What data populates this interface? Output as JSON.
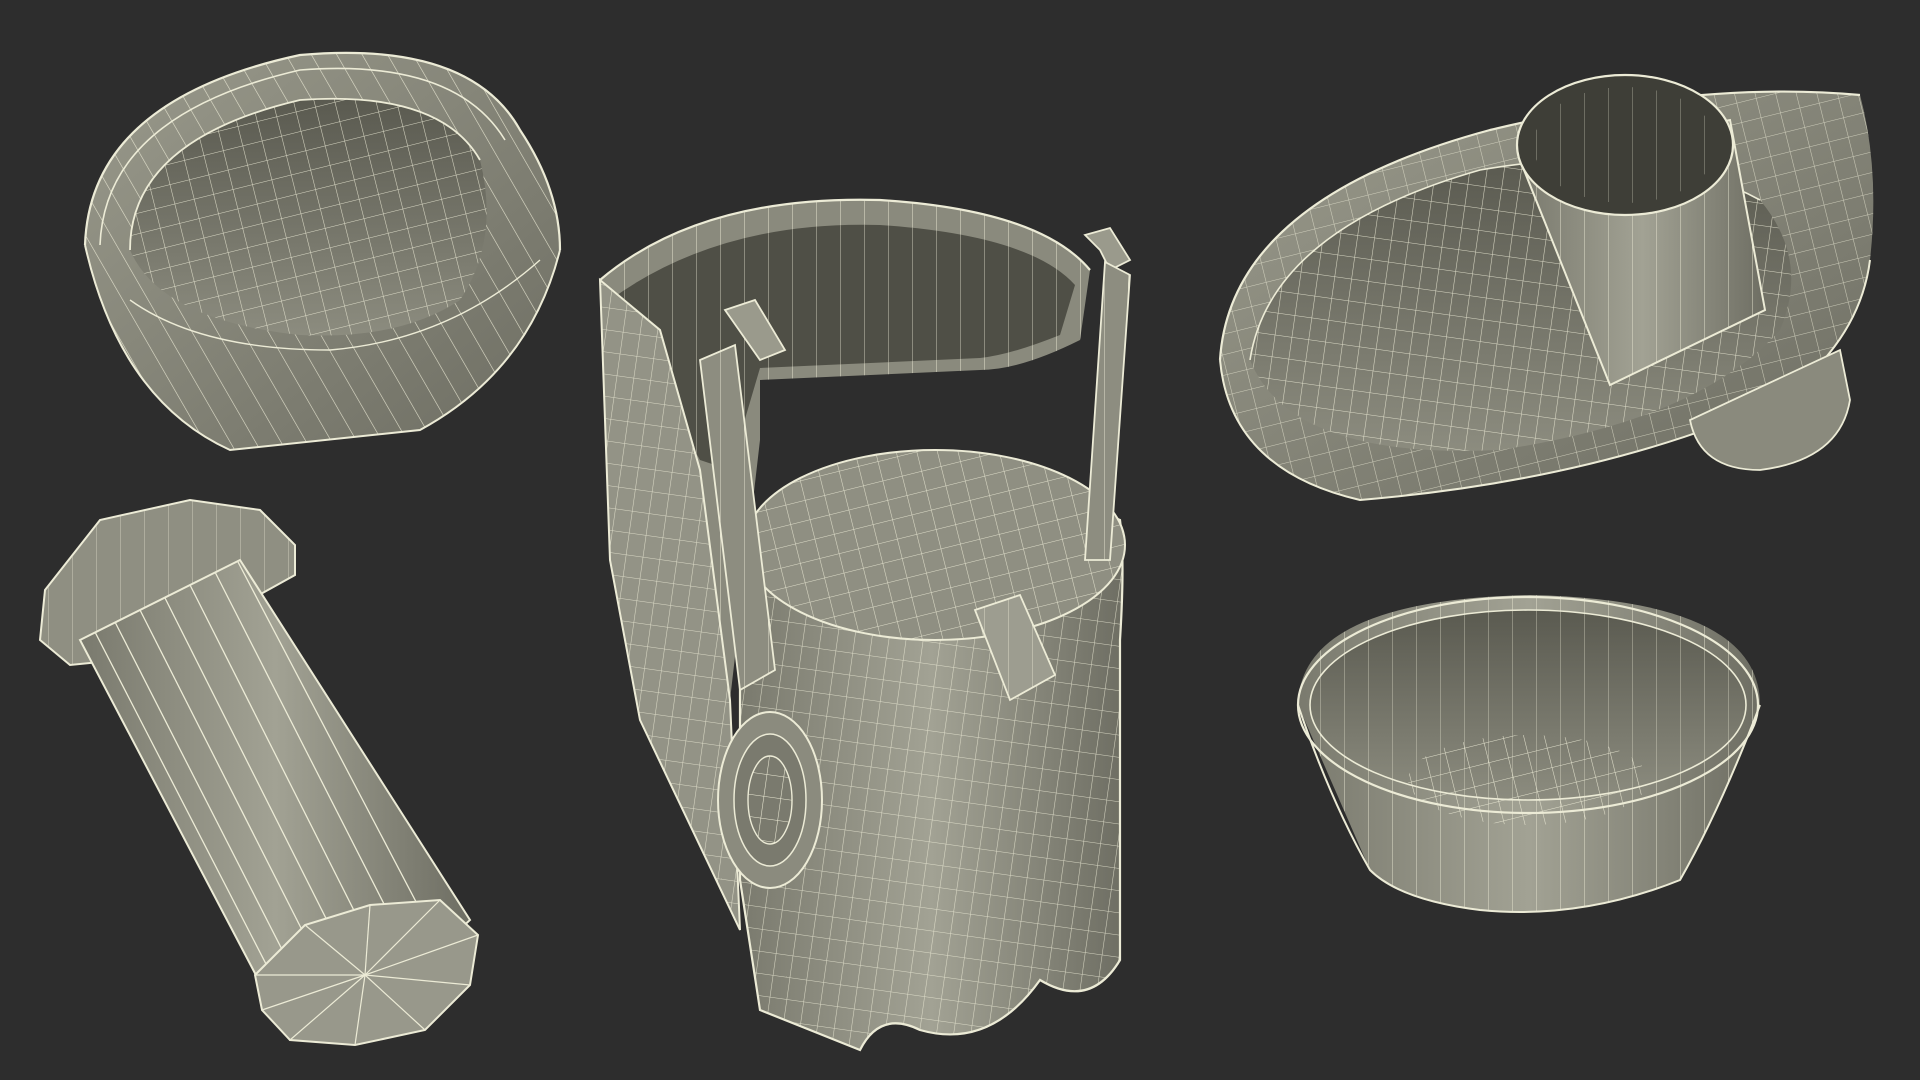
{
  "scene": {
    "background": "#2d2d2d",
    "model_fill": "#7f7f72",
    "model_fill_light": "#97978a",
    "model_fill_dark": "#5d5d52",
    "wire_color": "#ecebd6",
    "render_style": "wireframe-over-shaded"
  },
  "parts": [
    {
      "name": "lid-ring-bowl",
      "icon": "ring-bowl-icon"
    },
    {
      "name": "filter-cylinder",
      "icon": "cylinder-icon"
    },
    {
      "name": "juicer-base",
      "icon": "housing-icon"
    },
    {
      "name": "pulp-container-with-chute",
      "icon": "chute-bowl-icon"
    },
    {
      "name": "small-bowl",
      "icon": "bowl-icon"
    }
  ]
}
